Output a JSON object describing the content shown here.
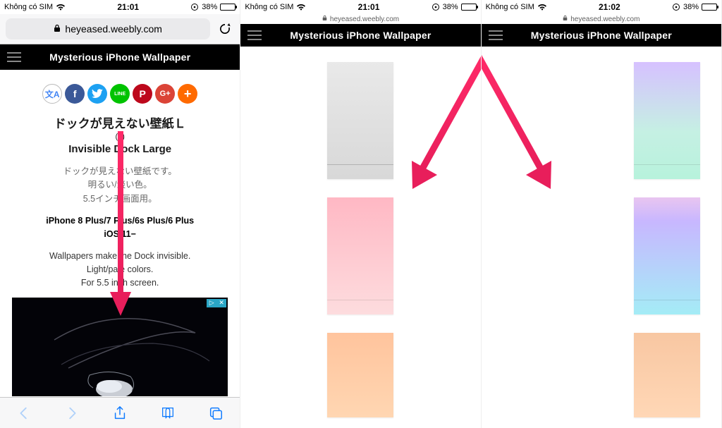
{
  "status": {
    "carrier": "Không có SIM",
    "battery_percent": "38%",
    "times": [
      "21:01",
      "21:01",
      "21:02"
    ]
  },
  "url_display": "heyeased.weebly.com",
  "site_title": "Mysterious iPhone Wallpaper",
  "screen1": {
    "title_jp": "ドックが見えない壁紙Ｌ",
    "subtitle": "(1)",
    "title_en": "Invisible Dock Large",
    "desc_jp_1": "ドックが見えない壁紙です。",
    "desc_jp_2": "明るい/淡い色。",
    "desc_jp_3": "5.5インチ画面用。",
    "device_line1": "iPhone 8 Plus/7 Plus/6s Plus/6 Plus",
    "device_line2": "iOS 11−",
    "desc_en_1": "Wallpapers make the Dock invisible.",
    "desc_en_2": "Light/pale colors.",
    "desc_en_3": "For 5.5 inch screen.",
    "social": {
      "translate": "文A",
      "facebook": "f",
      "twitter": "t",
      "line": "LINE",
      "pinterest": "P",
      "gplus": "G+",
      "share": "+"
    },
    "ad": {
      "close": "✕",
      "info": "▷"
    }
  }
}
